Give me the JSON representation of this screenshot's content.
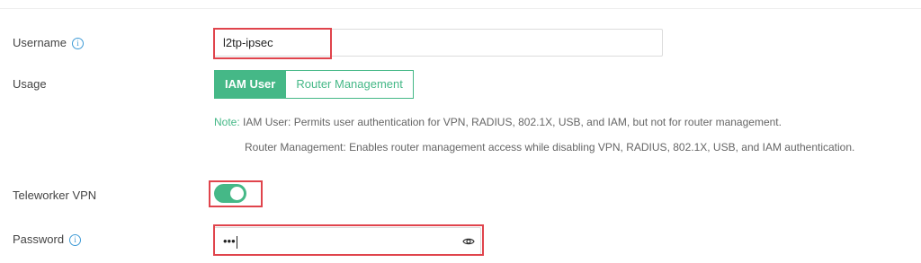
{
  "form": {
    "username": {
      "label": "Username",
      "info_icon": "info-icon",
      "value": "l2tp-ipsec"
    },
    "usage": {
      "label": "Usage",
      "options": [
        "IAM User",
        "Router Management"
      ],
      "selected": "IAM User",
      "note_label": "Note:",
      "note_line1": "IAM User: Permits user authentication for VPN, RADIUS, 802.1X, USB, and IAM, but not for router management.",
      "note_line2": "Router Management: Enables router management access while disabling VPN, RADIUS, 802.1X, USB, and IAM authentication."
    },
    "teleworker_vpn": {
      "label": "Teleworker VPN",
      "enabled": true
    },
    "password": {
      "label": "Password",
      "info_icon": "info-icon",
      "masked_value": "•••",
      "toggle_icon": "eye-icon"
    }
  },
  "colors": {
    "accent": "#45b887",
    "info": "#3f9bd6",
    "highlight": "#e0444c"
  }
}
